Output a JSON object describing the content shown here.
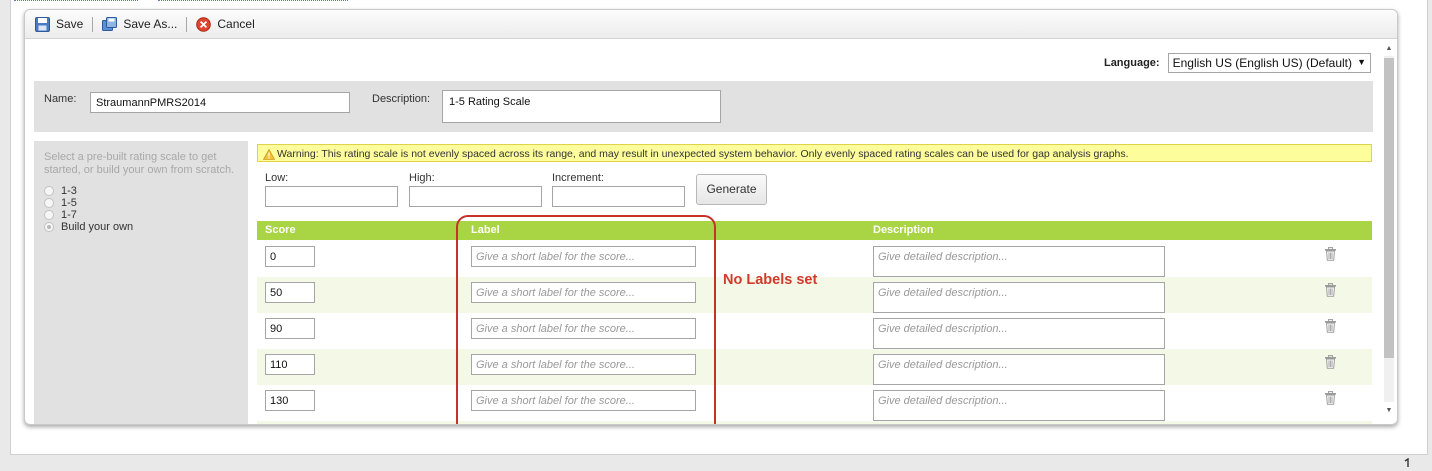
{
  "toolbar": {
    "save_label": "Save",
    "save_as_label": "Save As...",
    "cancel_label": "Cancel"
  },
  "language": {
    "label": "Language:",
    "value": "English US (English US) (Default)"
  },
  "form": {
    "name_label": "Name:",
    "name_value": "StraumannPMRS2014",
    "description_label": "Description:",
    "description_value": "1-5 Rating Scale"
  },
  "sidebar": {
    "hint": "Select a pre-built rating scale to get started, or build your own from scratch.",
    "options": [
      {
        "label": "1-3",
        "checked": false
      },
      {
        "label": "1-5",
        "checked": false
      },
      {
        "label": "1-7",
        "checked": false
      },
      {
        "label": "Build your own",
        "checked": true
      }
    ]
  },
  "warning": {
    "icon": "warning-icon",
    "text": "Warning: This rating scale is not evenly spaced across its range, and may result in unexpected system behavior. Only evenly spaced rating scales can be used for gap analysis graphs."
  },
  "generator": {
    "low_label": "Low:",
    "high_label": "High:",
    "increment_label": "Increment:",
    "low_value": "",
    "high_value": "",
    "increment_value": "",
    "generate_label": "Generate"
  },
  "grid": {
    "headers": {
      "score": "Score",
      "label": "Label",
      "description": "Description"
    },
    "label_placeholder": "Give a short label for the score...",
    "description_placeholder": "Give detailed description...",
    "rows": [
      {
        "score": "0"
      },
      {
        "score": "50"
      },
      {
        "score": "90"
      },
      {
        "score": "110"
      },
      {
        "score": "130"
      }
    ]
  },
  "annotation": {
    "text": "No Labels set",
    "color": "#d23a2e"
  },
  "colors": {
    "grid_header": "#a9d443",
    "warning_bg": "#fdfd9b",
    "row_alt": "#f4f8e6"
  }
}
